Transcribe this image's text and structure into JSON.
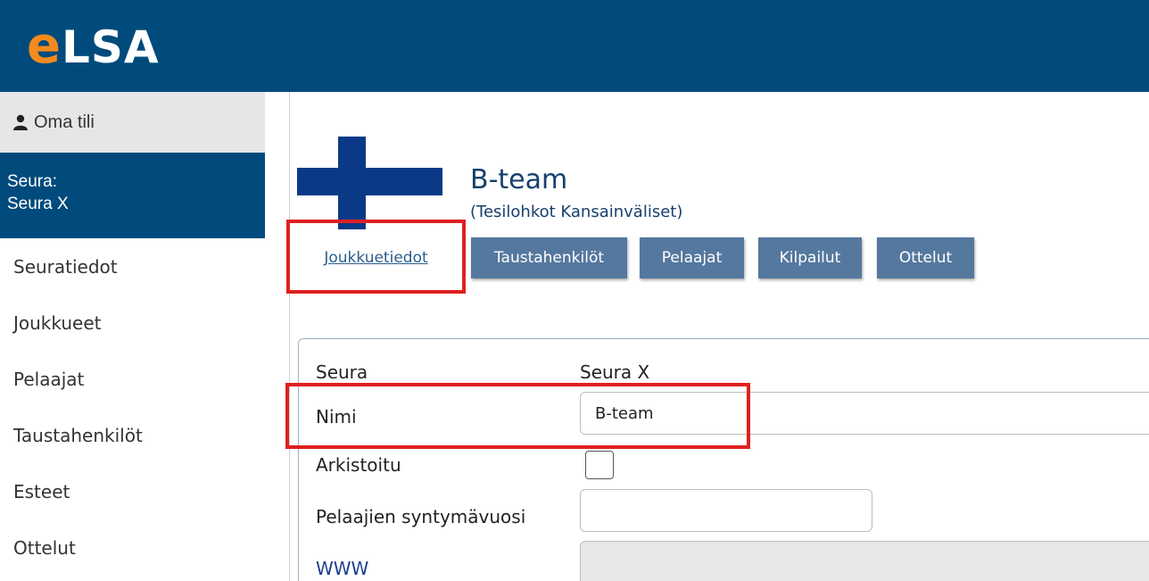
{
  "app": {
    "logo_e": "e",
    "logo_rest": "LSA"
  },
  "sidebar": {
    "account_label": "Oma tili",
    "club_line1": "Seura:",
    "club_line2": "Seura X",
    "items": [
      {
        "label": "Seuratiedot"
      },
      {
        "label": "Joukkueet"
      },
      {
        "label": "Pelaajat"
      },
      {
        "label": "Taustahenkilöt"
      },
      {
        "label": "Esteet"
      },
      {
        "label": "Ottelut"
      }
    ]
  },
  "team": {
    "name": "B-team",
    "subtitle": "(Tesilohkot Kansainväliset)"
  },
  "tabs": [
    {
      "label": "Joukkuetiedot",
      "active": true
    },
    {
      "label": "Taustahenkilöt"
    },
    {
      "label": "Pelaajat"
    },
    {
      "label": "Kilpailut"
    },
    {
      "label": "Ottelut"
    }
  ],
  "form": {
    "club_label": "Seura",
    "club_value": "Seura X",
    "name_label": "Nimi",
    "name_value": "B-team",
    "archived_label": "Arkistoitu",
    "archived_checked": false,
    "birthyear_label": "Pelaajien syntymävuosi",
    "birthyear_value": "",
    "www_label": "WWW",
    "www_value": ""
  },
  "colors": {
    "header": "#004b7c",
    "logo_accent": "#f58a1f",
    "tab": "#55789e",
    "highlight": "#e02020"
  }
}
